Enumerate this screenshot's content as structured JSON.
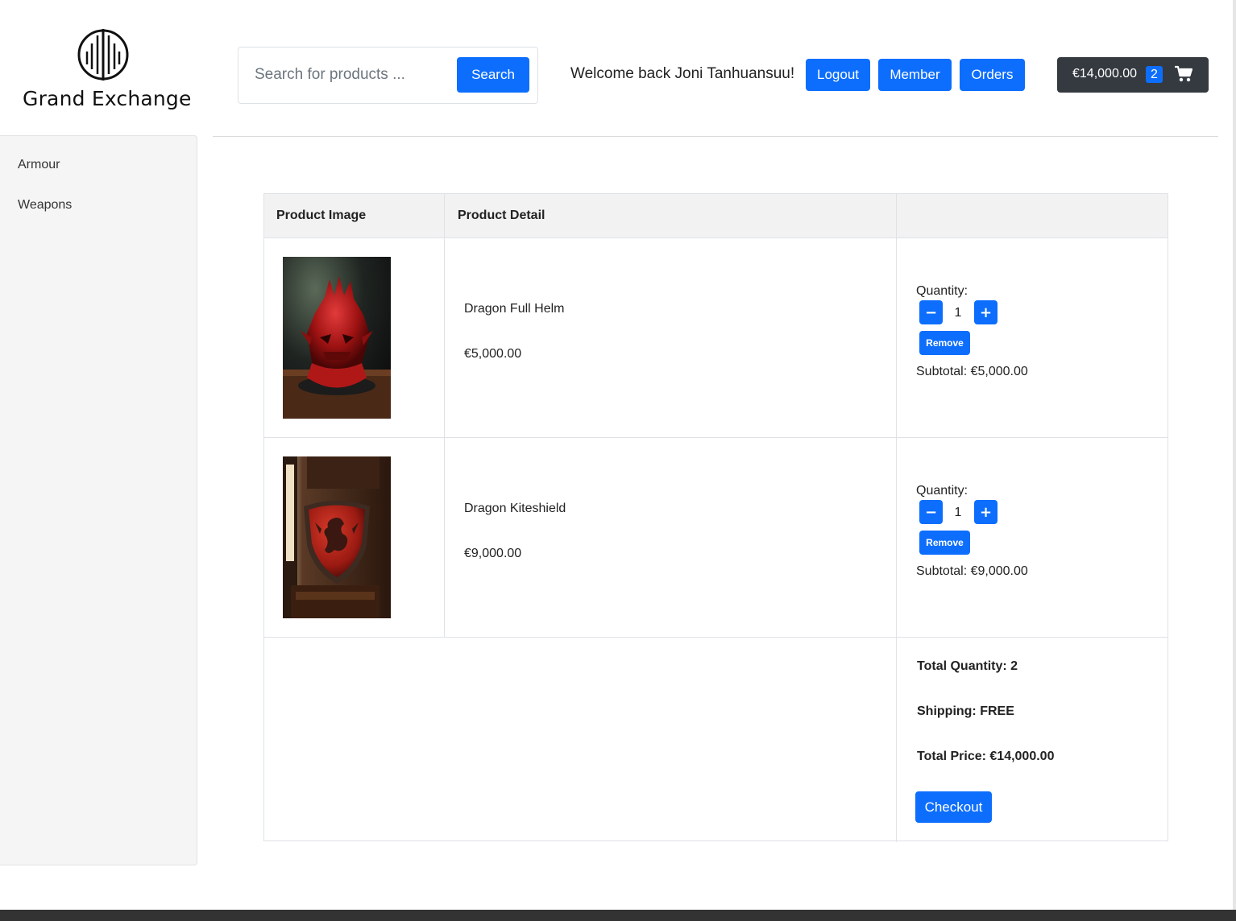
{
  "brand": {
    "name": "Grand Exchange",
    "logo_icon": "barcode-circle-logo"
  },
  "search": {
    "placeholder": "Search for products ...",
    "value": "",
    "button_label": "Search"
  },
  "header": {
    "welcome_text": "Welcome back Joni Tanhuansuu!",
    "logout_label": "Logout",
    "member_label": "Member",
    "orders_label": "Orders"
  },
  "cart_summary": {
    "total": "€14,000.00",
    "count": "2",
    "icon": "shopping-cart-icon"
  },
  "sidebar": {
    "items": [
      {
        "label": "Armour"
      },
      {
        "label": "Weapons"
      }
    ]
  },
  "table": {
    "headers": [
      "Product Image",
      "Product Detail",
      ""
    ],
    "items": [
      {
        "name": "Dragon Full Helm",
        "price": "€5,000.00",
        "quantity_label": "Quantity:",
        "quantity": "1",
        "remove_label": "Remove",
        "subtotal": "Subtotal: €5,000.00",
        "image": "red-dragon-helmet-image"
      },
      {
        "name": "Dragon Kiteshield",
        "price": "€9,000.00",
        "quantity_label": "Quantity:",
        "quantity": "1",
        "remove_label": "Remove",
        "subtotal": "Subtotal: €9,000.00",
        "image": "red-dragon-shield-image"
      }
    ],
    "summary": {
      "total_quantity": "Total Quantity: 2",
      "shipping": "Shipping: FREE",
      "total_price": "Total Price: €14,000.00",
      "checkout_label": "Checkout"
    }
  },
  "colors": {
    "primary": "#0d6efd",
    "dark": "#343a40",
    "sidebar_bg": "#f5f5f5",
    "header_bg": "#f2f2f2"
  }
}
